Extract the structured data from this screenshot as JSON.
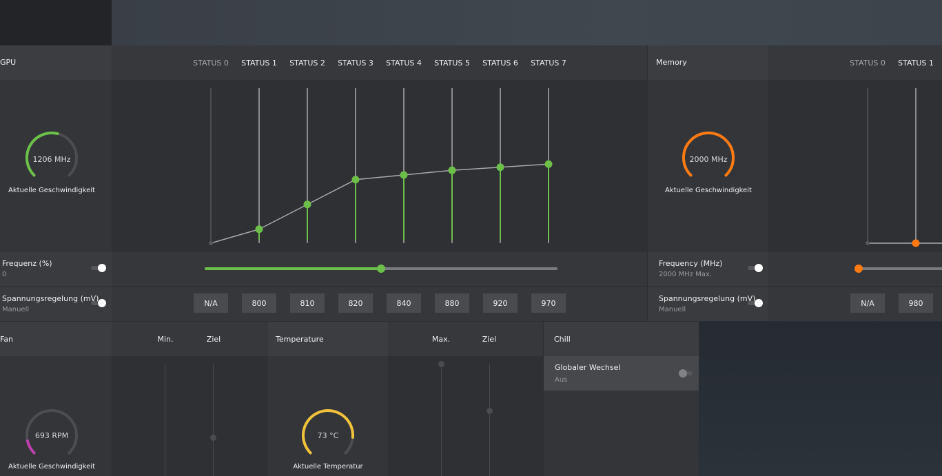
{
  "colors": {
    "gpu_accent": "#6cc04a",
    "memory_accent": "#ff7a12",
    "fan_accent": "#c03fb0",
    "temp_accent": "#f2c23a"
  },
  "gpu": {
    "title": "GPU",
    "states": [
      "STATUS 0",
      "STATUS 1",
      "STATUS 2",
      "STATUS 3",
      "STATUS 4",
      "STATUS 5",
      "STATUS 6",
      "STATUS 7"
    ],
    "gauge": {
      "value": "1206 MHz",
      "label": "Aktuelle Geschwindigkeit",
      "fraction": 0.55
    },
    "curve_levels": [
      0.0,
      0.09,
      0.25,
      0.41,
      0.44,
      0.47,
      0.49,
      0.51
    ],
    "frequency": {
      "title": "Frequenz (%)",
      "value": "0",
      "slider_fraction": 0.5
    },
    "voltage": {
      "title": "Spannungsregelung (mV)",
      "mode": "Manuell",
      "values": [
        "N/A",
        "800",
        "810",
        "820",
        "840",
        "880",
        "920",
        "970"
      ]
    }
  },
  "memory": {
    "title": "Memory",
    "states": [
      "STATUS 0",
      "STATUS 1"
    ],
    "gauge": {
      "value": "2000 MHz",
      "label": "Aktuelle Geschwindigkeit",
      "fraction": 1.0
    },
    "frequency": {
      "title": "Frequency (MHz)",
      "value": "2000 MHz Max."
    },
    "voltage": {
      "title": "Spannungsregelung (mV)",
      "mode": "Manuell",
      "values": [
        "N/A",
        "980"
      ]
    }
  },
  "fan": {
    "title": "Fan",
    "col_min": "Min.",
    "col_target": "Ziel",
    "gauge": {
      "value": "693 RPM",
      "label": "Aktuelle Geschwindigkeit",
      "fraction": 0.12
    }
  },
  "temperature": {
    "title": "Temperature",
    "col_max": "Max.",
    "col_target": "Ziel",
    "gauge": {
      "value": "73 °C",
      "label": "Aktuelle Temperatur",
      "fraction": 0.85
    }
  },
  "chill": {
    "title": "Chill",
    "global_switch": {
      "title": "Globaler Wechsel",
      "value": "Aus"
    }
  }
}
